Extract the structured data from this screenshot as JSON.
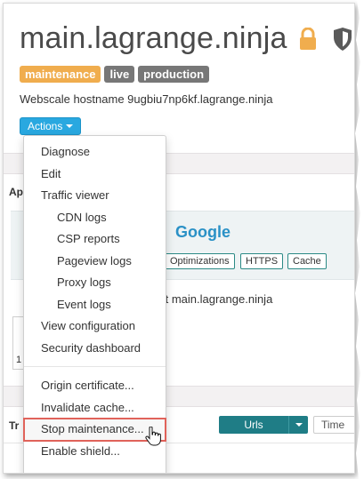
{
  "header": {
    "title": "main.lagrange.ninja",
    "badges": [
      "maintenance",
      "live",
      "production"
    ],
    "hostname": "Webscale hostname 9ugbiu7np6kf.lagrange.ninja",
    "actions_label": "Actions"
  },
  "background": {
    "section_letter_a": "Ap",
    "provider": "Google",
    "tags": [
      "Optimizations",
      "HTTPS",
      "Cache"
    ],
    "domain_fragment": "ft main.lagrange.ninja",
    "row_letters": "Tr",
    "urls_label": "Urls",
    "time_label": "Time",
    "left_digit": "1"
  },
  "menu": {
    "items": [
      {
        "label": "Diagnose"
      },
      {
        "label": "Edit"
      },
      {
        "label": "Traffic viewer"
      },
      {
        "label": "CDN logs"
      },
      {
        "label": "CSP reports"
      },
      {
        "label": "Pageview logs"
      },
      {
        "label": "Proxy logs"
      },
      {
        "label": "Event logs"
      },
      {
        "label": "View configuration"
      },
      {
        "label": "Security dashboard"
      },
      {
        "label": "Origin certificate..."
      },
      {
        "label": "Invalidate cache..."
      },
      {
        "label": "Stop maintenance..."
      },
      {
        "label": "Enable shield..."
      }
    ]
  },
  "colors": {
    "maintenance_badge": "#f0ad4e",
    "gray_badge": "#777777",
    "actions_button": "#29a8e0",
    "highlight_outline": "#e0625a",
    "provider_link": "#2a91c6",
    "urls_button": "#1f7d86"
  },
  "icons": {
    "lock": "lock-icon",
    "shield": "shield-icon",
    "cursor": "hand-pointer-icon"
  }
}
